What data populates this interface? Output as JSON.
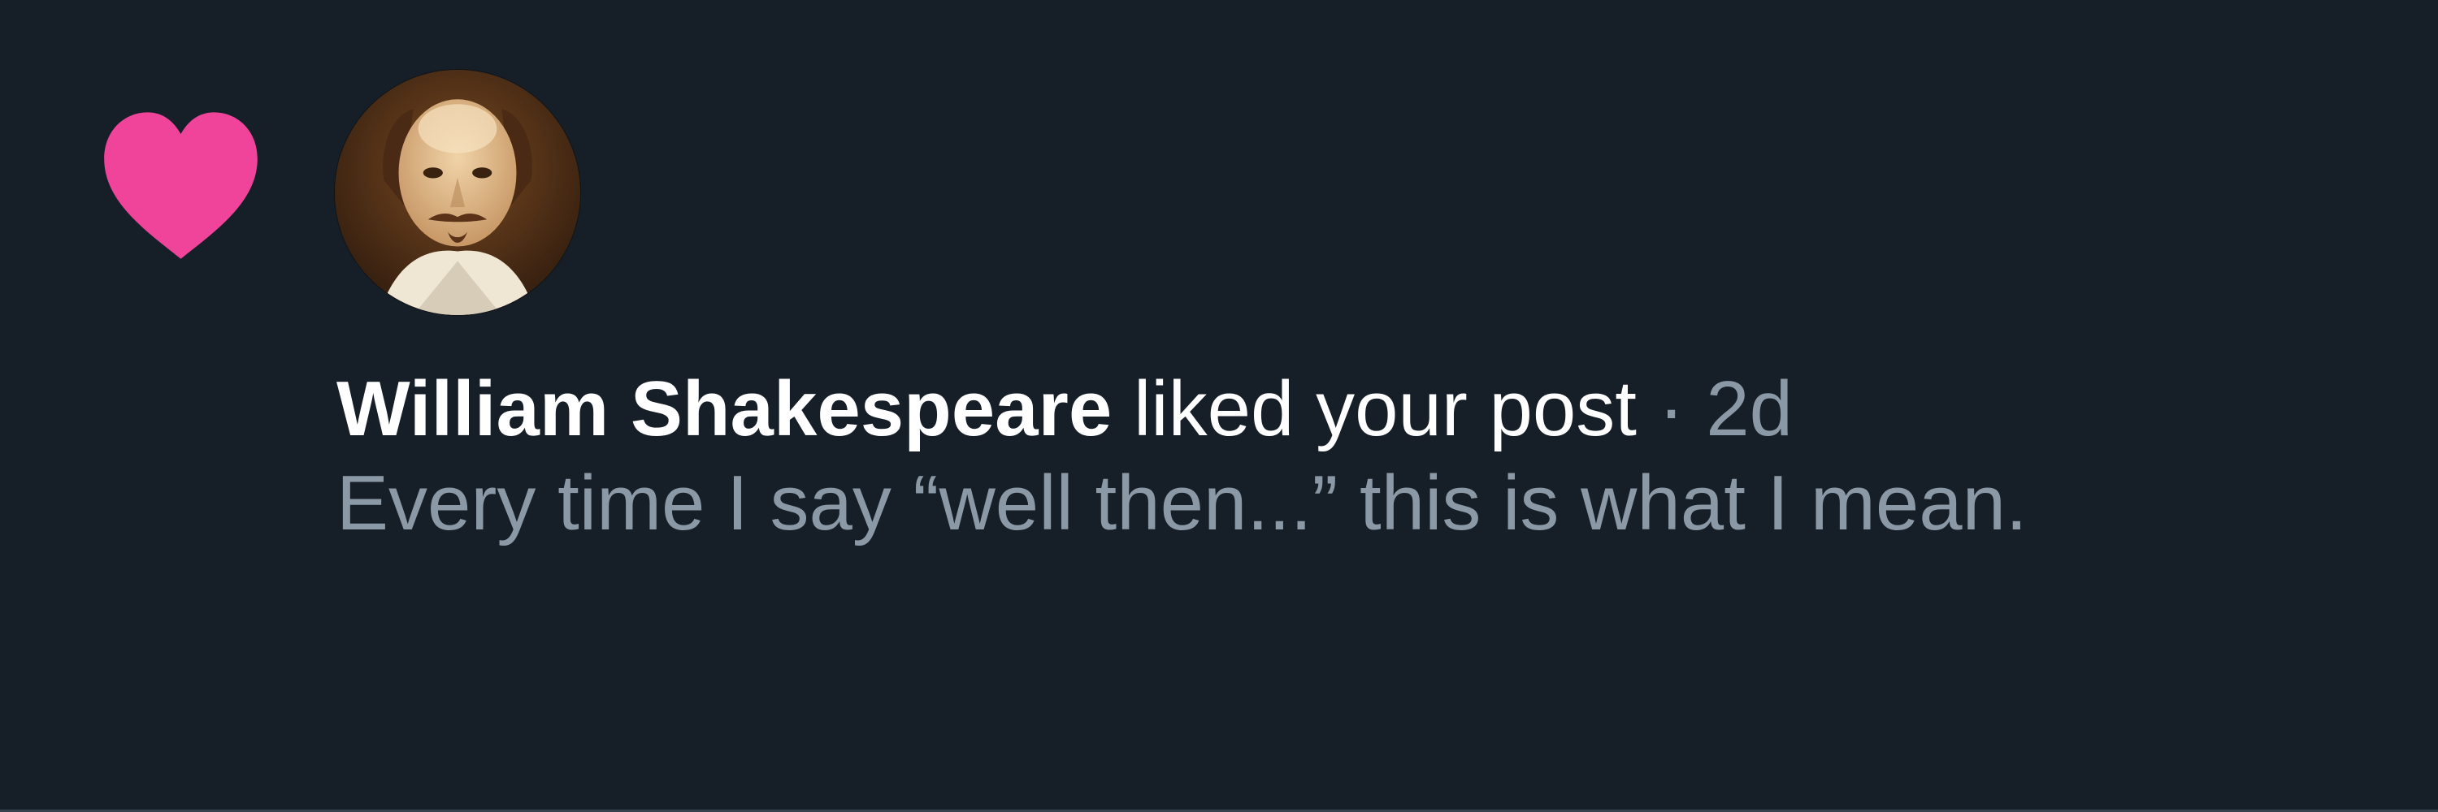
{
  "notification": {
    "type_icon": "heart-icon",
    "type_color": "#f0449b",
    "avatar_icon": "user-avatar-portrait",
    "actor": "William Shakespeare",
    "action": "liked your post",
    "separator": "·",
    "time": "2d",
    "post_text": "Every time I say “well then...” this is what I mean."
  },
  "colors": {
    "background": "#161e27",
    "primary_text": "#ffffff",
    "secondary_text": "#8b98a5",
    "like_pink": "#f0449b"
  }
}
